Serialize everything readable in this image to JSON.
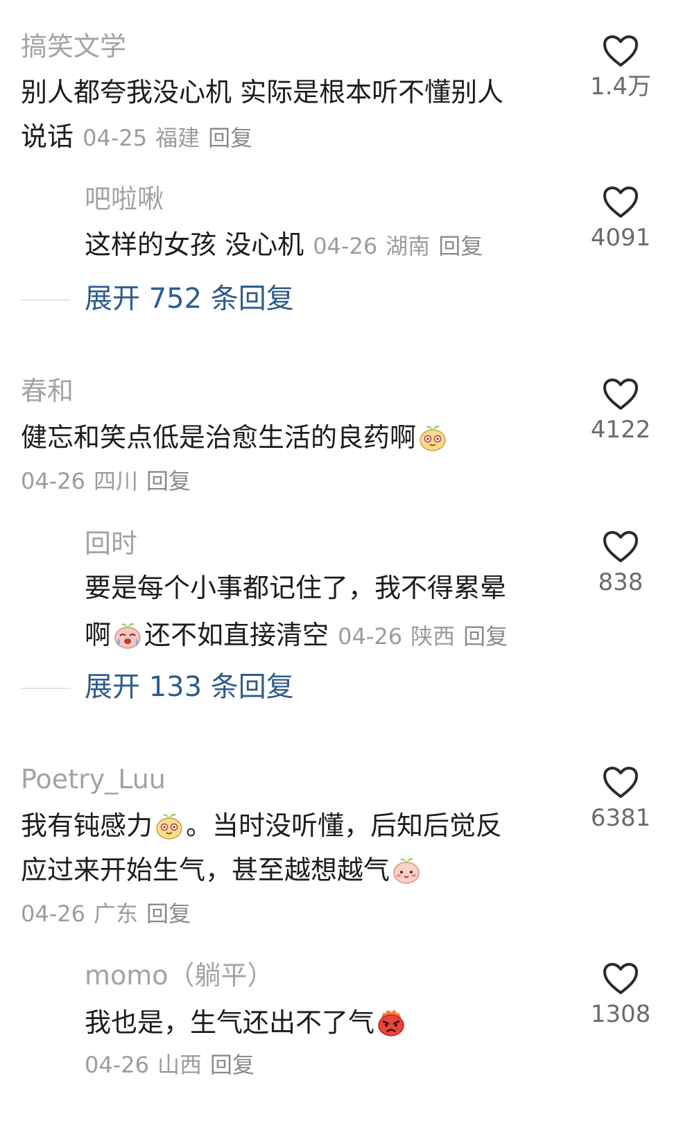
{
  "comments": [
    {
      "username": "搞笑文学",
      "text_line1": "别人都夸我没心机 实际是根本听不懂别人",
      "text_line2": "说话",
      "date": "04-25",
      "location": "福建",
      "reply_label": "回复",
      "likes": "1.4万",
      "replies": [
        {
          "username": "吧啦啾",
          "text": "这样的女孩 没心机",
          "date": "04-26",
          "location": "湖南",
          "reply_label": "回复",
          "likes": "4091"
        }
      ],
      "expand_label": "展开 752 条回复"
    },
    {
      "username": "春和",
      "text": "健忘和笑点低是治愈生活的良药啊",
      "date": "04-26",
      "location": "四川",
      "reply_label": "回复",
      "likes": "4122",
      "replies": [
        {
          "username": "回时",
          "text_line1": "要是每个小事都记住了，我不得累晕",
          "text_line2a": "啊",
          "text_line2b": "还不如直接清空",
          "date": "04-26",
          "location": "陕西",
          "reply_label": "回复",
          "likes": "838"
        }
      ],
      "expand_label": "展开 133 条回复"
    },
    {
      "username": "Poetry_Luu",
      "text_line1a": "我有钝感力",
      "text_line1b": "。当时没听懂，后知后觉反",
      "text_line2": "应过来开始生气，甚至越想越气",
      "date": "04-26",
      "location": "广东",
      "reply_label": "回复",
      "likes": "6381",
      "replies": [
        {
          "username": "momo（躺平）",
          "text": "我也是，生气还出不了气",
          "date": "04-26",
          "location": "山西",
          "reply_label": "回复",
          "likes": "1308"
        }
      ]
    }
  ],
  "icons": {
    "like": "heart-outline-icon",
    "emoji_sprout": "sprout-face-emoji",
    "emoji_cry": "crying-face-emoji",
    "emoji_shy": "shy-face-emoji",
    "emoji_angry": "angry-face-emoji"
  },
  "colors": {
    "username": "#a3a3a3",
    "text": "#1c1c1c",
    "meta": "#9c9c9c",
    "expand": "#2d5b8e"
  }
}
